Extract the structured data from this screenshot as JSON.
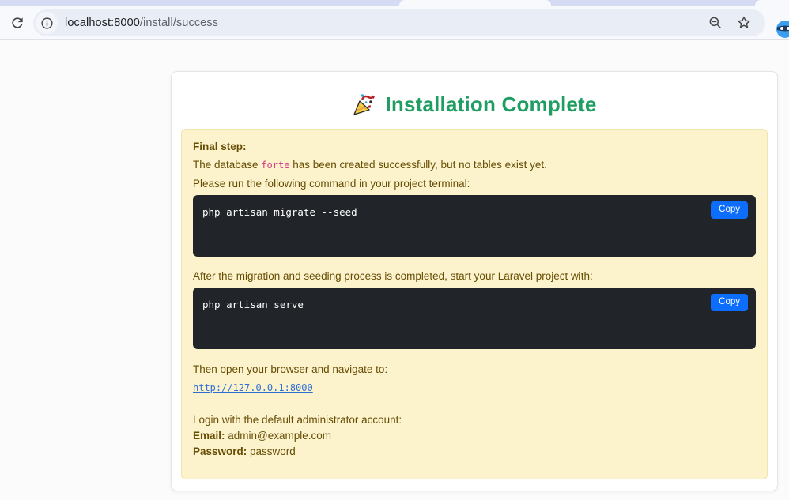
{
  "browser": {
    "address_bar": {
      "host": "localhost:8000",
      "path": "/install/success"
    },
    "icons": {
      "reload": "reload-icon",
      "page_info": "page-info-icon",
      "zoom_out": "zoom-out-icon",
      "bookmark": "bookmark-star-icon",
      "profile": "masked-avatar-icon"
    }
  },
  "page": {
    "title": "Installation Complete",
    "title_icon": "party-popper-icon",
    "colors": {
      "title_green": "#1f9d63",
      "alert_bg": "#fcf3cd",
      "alert_text": "#664d03",
      "code_block_bg": "#212529",
      "copy_button_blue": "#0d6efd",
      "inline_code_pink": "#d63384",
      "link_blue": "#2e6fd3"
    },
    "alert": {
      "final_step_label": "Final step:",
      "db_line_pre": "The database ",
      "db_name": "forte",
      "db_line_post": " has been created successfully, but no tables exist yet.",
      "run_command_line": "Please run the following command in your project terminal:",
      "code1": "php artisan migrate --seed",
      "copy_label": "Copy",
      "after_migration_line": "After the migration and seeding process is completed, start your Laravel project with:",
      "code2": "php artisan serve",
      "navigate_line": "Then open your browser and navigate to:",
      "app_link": "http://127.0.0.1:8000",
      "login_line": "Login with the default administrator account:",
      "email_label": "Email:",
      "email_value": " admin@example.com",
      "password_label": "Password:",
      "password_value": " password"
    }
  }
}
